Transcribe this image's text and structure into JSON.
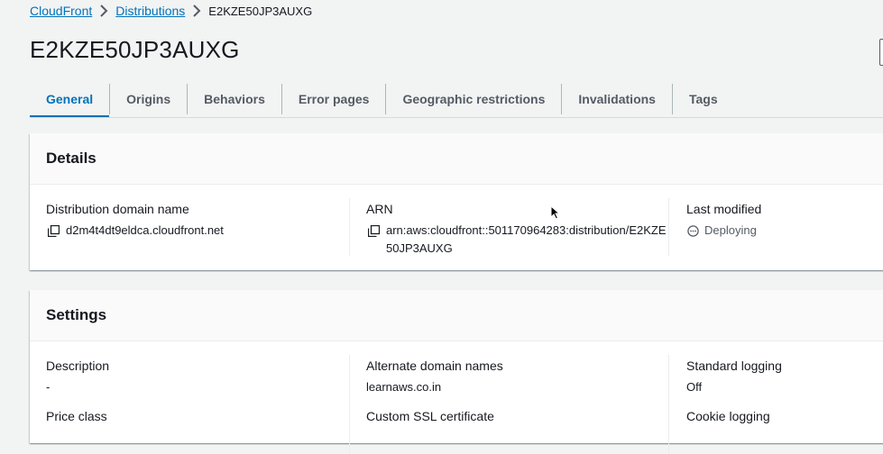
{
  "breadcrumb": {
    "items": [
      "CloudFront",
      "Distributions"
    ],
    "current": "E2KZE50JP3AUXG"
  },
  "page": {
    "title": "E2KZE50JP3AUXG"
  },
  "tabs": [
    {
      "label": "General",
      "active": true
    },
    {
      "label": "Origins",
      "active": false
    },
    {
      "label": "Behaviors",
      "active": false
    },
    {
      "label": "Error pages",
      "active": false
    },
    {
      "label": "Geographic restrictions",
      "active": false
    },
    {
      "label": "Invalidations",
      "active": false
    },
    {
      "label": "Tags",
      "active": false
    }
  ],
  "details": {
    "title": "Details",
    "domain_label": "Distribution domain name",
    "domain_value": "d2m4t4dt9eldca.cloudfront.net",
    "arn_label": "ARN",
    "arn_value": "arn:aws:cloudfront::501170964283:distribution/E2KZE50JP3AUXG",
    "modified_label": "Last modified",
    "modified_value": "Deploying"
  },
  "settings": {
    "title": "Settings",
    "description_label": "Description",
    "description_value": "-",
    "alt_domains_label": "Alternate domain names",
    "alt_domains_value": "learnaws.co.in",
    "std_logging_label": "Standard logging",
    "std_logging_value": "Off",
    "price_class_label": "Price class",
    "ssl_label": "Custom SSL certificate",
    "cookie_logging_label": "Cookie logging"
  },
  "colors": {
    "link": "#0073bb",
    "background": "#f2f3f3",
    "panel": "#ffffff",
    "text": "#16191f",
    "muted": "#545b64"
  },
  "icons": {
    "copy": "copy-icon",
    "status": "in-progress-icon",
    "separator": "chevron-right-icon",
    "cursor": "mouse-pointer-icon"
  }
}
